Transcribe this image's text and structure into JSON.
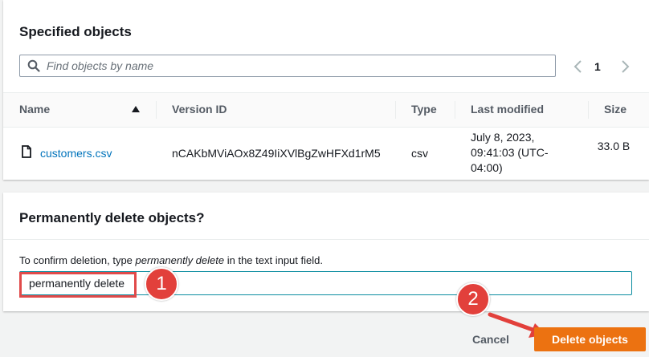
{
  "specified_objects": {
    "title": "Specified objects",
    "search_placeholder": "Find objects by name",
    "pagination": {
      "current_page": "1"
    },
    "columns": {
      "name": "Name",
      "version_id": "Version ID",
      "type": "Type",
      "last_modified": "Last modified",
      "size": "Size"
    },
    "rows": [
      {
        "name": "customers.csv",
        "version_id": "nCAKbMViAOx8Z49IiXVlBgZwHFXd1rM5",
        "type": "csv",
        "last_modified": "July 8, 2023, 09:41:03 (UTC-04:00)",
        "size": "33.0 B"
      }
    ]
  },
  "delete_section": {
    "title": "Permanently delete objects?",
    "instruction_prefix": "To confirm deletion, type ",
    "instruction_phrase": "permanently delete",
    "instruction_suffix": " in the text input field.",
    "input_value": "permanently delete"
  },
  "actions": {
    "cancel_label": "Cancel",
    "delete_label": "Delete objects"
  },
  "callouts": {
    "step_1": "1",
    "step_2": "2"
  },
  "colors": {
    "primary_button": "#ec7211",
    "link": "#0073bb",
    "input_focus": "#0a8ca0",
    "callout": "#e2403b"
  }
}
